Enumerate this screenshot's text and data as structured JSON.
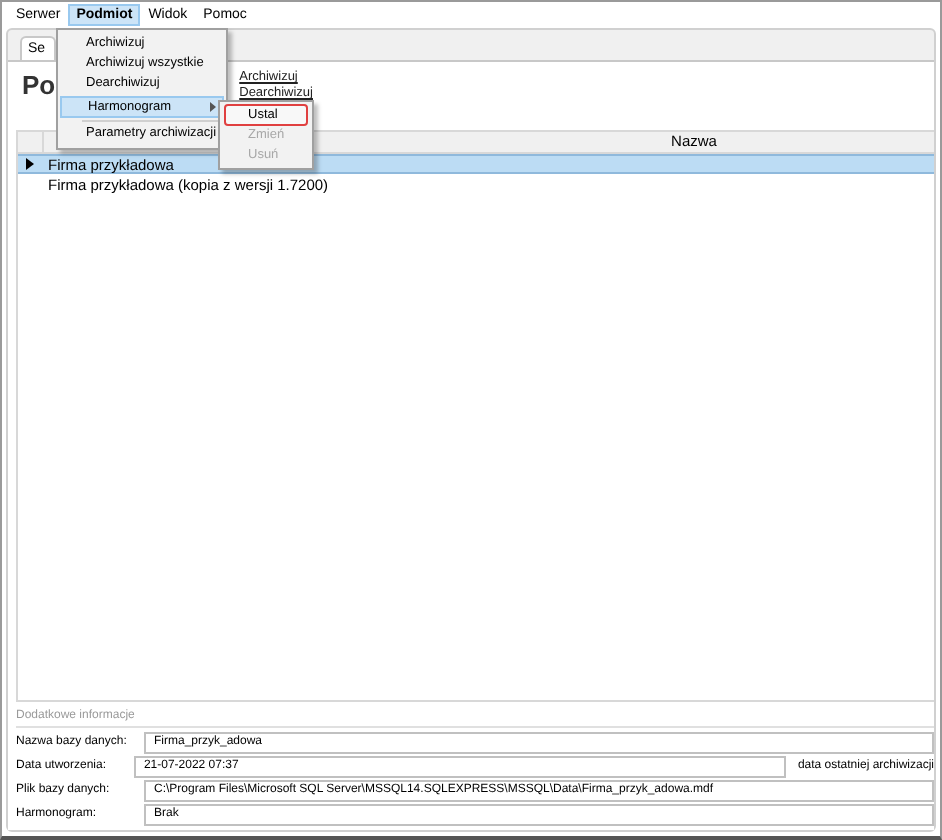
{
  "menu_bar": [
    {
      "label": "Serwer",
      "selected": false
    },
    {
      "label": "Podmiot",
      "selected": true
    },
    {
      "label": "Widok",
      "selected": false
    },
    {
      "label": "Pomoc",
      "selected": false
    }
  ],
  "open_menu": {
    "items": [
      {
        "label": "Archiwizuj",
        "highlighted": false,
        "has_submenu": false
      },
      {
        "label": "Archiwizuj wszystkie",
        "highlighted": false,
        "has_submenu": false
      },
      {
        "label": "Dearchiwizuj",
        "highlighted": false,
        "has_submenu": false
      },
      {
        "label": "Harmonogram",
        "highlighted": true,
        "has_submenu": true
      },
      {
        "label": "Parametry archiwizacji",
        "highlighted": false,
        "has_submenu": false
      }
    ]
  },
  "submenu": {
    "items": [
      {
        "label": "Ustal",
        "disabled": false,
        "highlighted": true
      },
      {
        "label": "Zmień",
        "disabled": true,
        "highlighted": false
      },
      {
        "label": "Usuń",
        "disabled": true,
        "highlighted": false
      }
    ]
  },
  "tabs": [
    {
      "label": "Se",
      "selected": true
    }
  ],
  "panel": {
    "title": "Po",
    "actions": [
      "Archiwizuj",
      "Dearchiwizuj"
    ]
  },
  "table": {
    "columns": [
      "Nazwa"
    ],
    "rows": [
      {
        "cells": [
          "Firma przykładowa"
        ],
        "selected": true
      },
      {
        "cells": [
          "Firma przykładowa (kopia z wersji 1.7200)"
        ],
        "selected": false
      }
    ]
  },
  "details": {
    "title": "Dodatkowe informacje",
    "fields": [
      {
        "label": "Nazwa bazy danych:",
        "value": "Firma_przyk_adowa"
      },
      {
        "label": "Data utworzenia:",
        "value": "21-07-2022 07:37",
        "note": "data ostatniej archiwizacji"
      },
      {
        "label": "Plik bazy danych:",
        "value": "C:\\Program Files\\Microsoft SQL Server\\MSSQL14.SQLEXPRESS\\MSSQL\\Data\\Firma_przyk_adowa.mdf"
      },
      {
        "label": "Harmonogram:",
        "value": "Brak"
      }
    ]
  }
}
